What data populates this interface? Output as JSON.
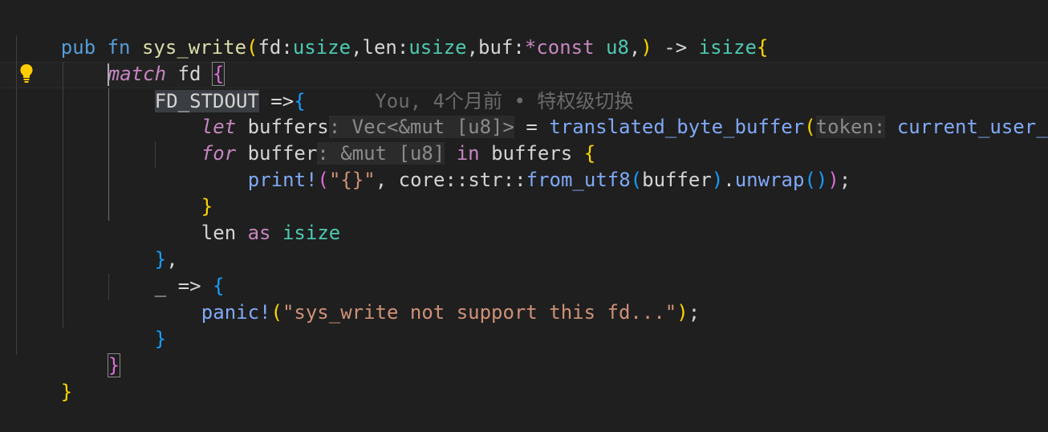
{
  "editor": {
    "lines": {
      "l1": {
        "pub": "pub",
        "fn": "fn",
        "name": "sys_write",
        "lp": "(",
        "p_fd": "fd",
        "c1": ":",
        "usize1": "usize",
        "comma1": ",",
        "p_len": "len",
        "c2": ":",
        "usize2": "usize",
        "comma2": ",",
        "p_buf": "buf",
        "c3": ":",
        "star": "*",
        "const": "const",
        "u8": "u8",
        "comma3": ",",
        "rp": ")",
        "arrow": "->",
        "isize": "isize",
        "lb": "{"
      },
      "l2": {
        "match": "match",
        "fd": "fd",
        "lb": "{"
      },
      "l3": {
        "fd_stdout": "FD_STDOUT",
        "arrow": "=>",
        "lb": "{",
        "blame": "You, 4个月前 • 特权级切换"
      },
      "l4": {
        "let": "let",
        "var": "buffers",
        "hint": ": Vec<&mut [u8]>",
        "eq": "=",
        "fn": "translated_byte_buffer",
        "lp": "(",
        "param_hint": "token:",
        "arg": "current_user_toke"
      },
      "l5": {
        "for": "for",
        "var": "buffer",
        "hint": ": &mut [u8]",
        "in": "in",
        "iter": "buffers",
        "lb": "{"
      },
      "l6": {
        "mac": "print!",
        "lp": "(",
        "str": "\"{}\"",
        "comma": ",",
        "core": "core",
        "sep1": "::",
        "str_mod": "str",
        "sep2": "::",
        "fn": "from_utf8",
        "lp2": "(",
        "arg": "buffer",
        "rp2": ")",
        "dot": ".",
        "unwrap": "unwrap",
        "paren": "()",
        "rp": ")",
        "semi": ";"
      },
      "l7": {
        "rb": "}"
      },
      "l8": {
        "len": "len",
        "as": "as",
        "isize": "isize"
      },
      "l9": {
        "rb": "}",
        "comma": ","
      },
      "l10": {
        "wild": "_",
        "arrow": "=>",
        "lb": "{"
      },
      "l11": {
        "mac": "panic!",
        "lp": "(",
        "str": "\"sys_write not support this fd...\"",
        "rp": ")",
        "semi": ";"
      },
      "l12": {
        "rb": "}"
      },
      "l13": {
        "rb": "}"
      },
      "l14": {
        "rb": "}"
      }
    },
    "icons": {
      "lightbulb": "lightbulb-icon"
    },
    "colors": {
      "background": "#1f1f1f",
      "keyword": "#c586c0",
      "keyword_blue": "#569cd6",
      "function": "#dcdcaa",
      "type": "#4ec9b0",
      "string": "#ce9178",
      "bracket_gold": "#ffd700",
      "bracket_purple": "#da70d6",
      "bracket_blue": "#179fff",
      "inlay_hint": "#8b8b8b",
      "blame": "#6b6b6b"
    }
  }
}
